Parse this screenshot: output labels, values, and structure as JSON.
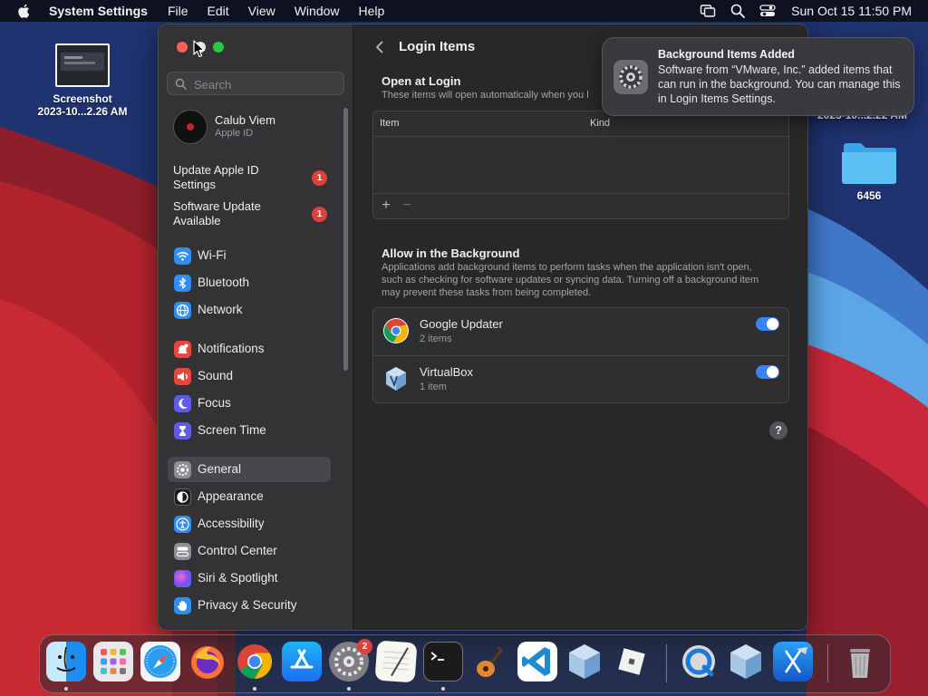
{
  "menubar": {
    "app_name": "System Settings",
    "menus": [
      "File",
      "Edit",
      "View",
      "Window",
      "Help"
    ],
    "clock": "Sun Oct 15  11:50 PM"
  },
  "desktop": {
    "screenshot": {
      "line1": "Screenshot",
      "line2": "2023-10...2.26 AM"
    },
    "hidden_item_date": "2023-10...2.22 AM",
    "folder_label": "6456"
  },
  "sidebar": {
    "search_placeholder": "Search",
    "account": {
      "name": "Calub Viem",
      "sub": "Apple ID"
    },
    "notices": [
      {
        "label": "Update Apple ID Settings",
        "badge": "1"
      },
      {
        "label": "Software Update Available",
        "badge": "1"
      }
    ],
    "items": [
      {
        "label": "Wi-Fi",
        "icon": "wifi-icon",
        "color": "#2f8ef6"
      },
      {
        "label": "Bluetooth",
        "icon": "bluetooth-icon",
        "color": "#2f8ef6"
      },
      {
        "label": "Network",
        "icon": "network-icon",
        "color": "#2f8ef6"
      },
      {
        "label": "Notifications",
        "icon": "notifications-icon",
        "color": "#e8453c"
      },
      {
        "label": "Sound",
        "icon": "sound-icon",
        "color": "#e8453c"
      },
      {
        "label": "Focus",
        "icon": "focus-icon",
        "color": "#5e5ce6"
      },
      {
        "label": "Screen Time",
        "icon": "screen-time-icon",
        "color": "#5e5ce6"
      },
      {
        "label": "General",
        "icon": "general-gear-icon",
        "color": "#8e8e93"
      },
      {
        "label": "Appearance",
        "icon": "appearance-icon",
        "color": "#1c1c1e"
      },
      {
        "label": "Accessibility",
        "icon": "accessibility-icon",
        "color": "#2f8ef6"
      },
      {
        "label": "Control Center",
        "icon": "control-center-icon",
        "color": "#8e8e93"
      },
      {
        "label": "Siri & Spotlight",
        "icon": "siri-icon",
        "color": "#b04ad6"
      },
      {
        "label": "Privacy & Security",
        "icon": "privacy-hand-icon",
        "color": "#2f8ef6"
      }
    ],
    "selected": "General"
  },
  "main": {
    "title": "Login Items",
    "open_at_login": {
      "title": "Open at Login",
      "desc": "These items will open automatically when you l",
      "columns": [
        "Item",
        "Kind"
      ],
      "add": "+",
      "remove": "−"
    },
    "background": {
      "title": "Allow in the Background",
      "desc": "Applications add background items to perform tasks when the application isn't open, such as checking for software updates or syncing data. Turning off a background item may prevent these tasks from being completed.",
      "items": [
        {
          "name": "Google Updater",
          "count": "2 items",
          "enabled": true
        },
        {
          "name": "VirtualBox",
          "count": "1 item",
          "enabled": true
        }
      ]
    },
    "help": "?"
  },
  "notification": {
    "title": "Background Items Added",
    "body": "Software from “VMware, Inc.” added items that can run in the background. You can manage this in Login Items Settings."
  },
  "dock": {
    "apps": [
      {
        "name": "Finder",
        "icon": "finder-icon"
      },
      {
        "name": "Launchpad",
        "icon": "launchpad-icon"
      },
      {
        "name": "Safari",
        "icon": "safari-icon"
      },
      {
        "name": "Firefox",
        "icon": "firefox-icon"
      },
      {
        "name": "Google Chrome",
        "icon": "chrome-icon"
      },
      {
        "name": "App Store",
        "icon": "app-store-icon"
      },
      {
        "name": "System Settings",
        "icon": "system-settings-icon",
        "badge": "2"
      },
      {
        "name": "TextEdit",
        "icon": "textedit-icon"
      },
      {
        "name": "Terminal",
        "icon": "terminal-icon"
      },
      {
        "name": "GarageBand",
        "icon": "garageband-icon"
      },
      {
        "name": "Visual Studio Code",
        "icon": "vscode-icon"
      },
      {
        "name": "VirtualBox",
        "icon": "virtualbox-icon"
      },
      {
        "name": "Roblox",
        "icon": "roblox-icon"
      },
      {
        "name": "QuickTime Player",
        "icon": "quicktime-icon"
      },
      {
        "name": "VirtualBox",
        "icon": "virtualbox-icon"
      },
      {
        "name": "Xcode",
        "icon": "xcode-icon"
      },
      {
        "name": "Trash",
        "icon": "trash-icon"
      }
    ]
  }
}
